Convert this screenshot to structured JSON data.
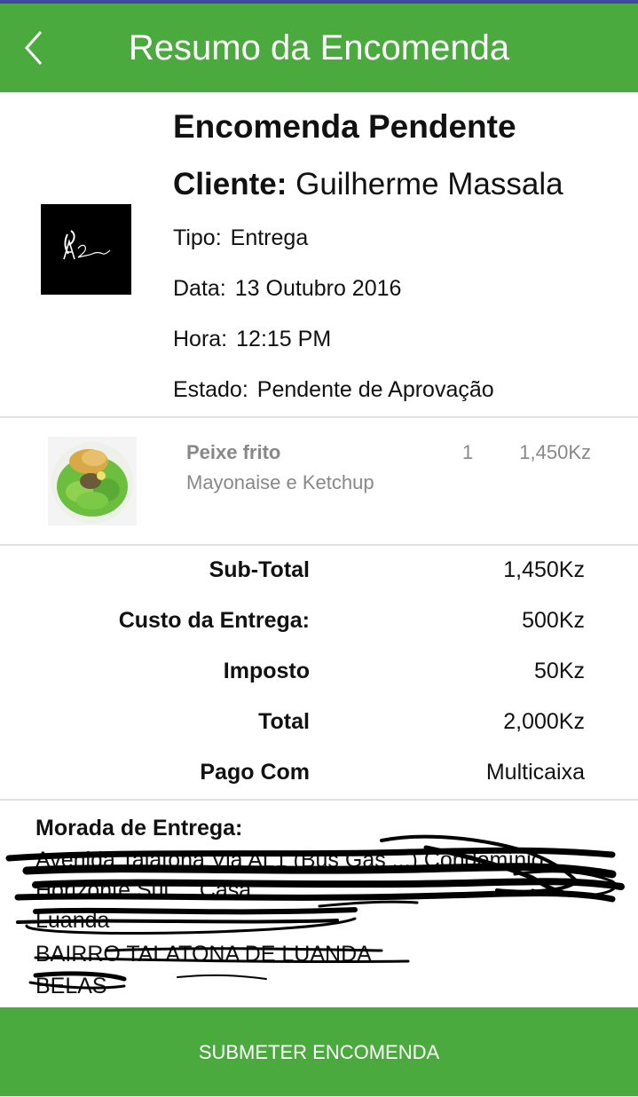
{
  "appbar": {
    "title": "Resumo da Encomenda"
  },
  "order": {
    "status_title": "Encomenda Pendente",
    "client_label": "Cliente:",
    "client_name": "Guilherme Massala",
    "tipo_label": "Tipo:",
    "tipo_value": "Entrega",
    "data_label": "Data:",
    "data_value": "13 Outubro 2016",
    "hora_label": "Hora:",
    "hora_value": "12:15 PM",
    "estado_label": "Estado:",
    "estado_value": "Pendente de Aprovação"
  },
  "logo": {
    "text": "A Romas"
  },
  "items": [
    {
      "name": "Peixe frito",
      "description": "Mayonaise e Ketchup",
      "quantity": "1",
      "price": "1,450Kz"
    }
  ],
  "summary": {
    "subtotal_label": "Sub-Total",
    "subtotal_value": "1,450Kz",
    "delivery_label": "Custo da Entrega:",
    "delivery_value": "500Kz",
    "tax_label": "Imposto",
    "tax_value": "50Kz",
    "total_label": "Total",
    "total_value": "2,000Kz",
    "paid_label": "Pago Com",
    "paid_value": "Multicaixa"
  },
  "address": {
    "title": "Morada de Entrega:",
    "lines": [
      "Avenida Talatona Via AL1 (Bus Gás ...) Condomínio",
      "Horizonte Sul ... Casa ...",
      "Luanda",
      "BAIRRO TALATONA DE LUANDA",
      "BELAS"
    ]
  },
  "actions": {
    "submit_label": "SUBMETER ENCOMENDA"
  },
  "colors": {
    "primary_green": "#4aaa3e",
    "top_strip": "#3b4aa0",
    "muted_text": "#888888"
  }
}
